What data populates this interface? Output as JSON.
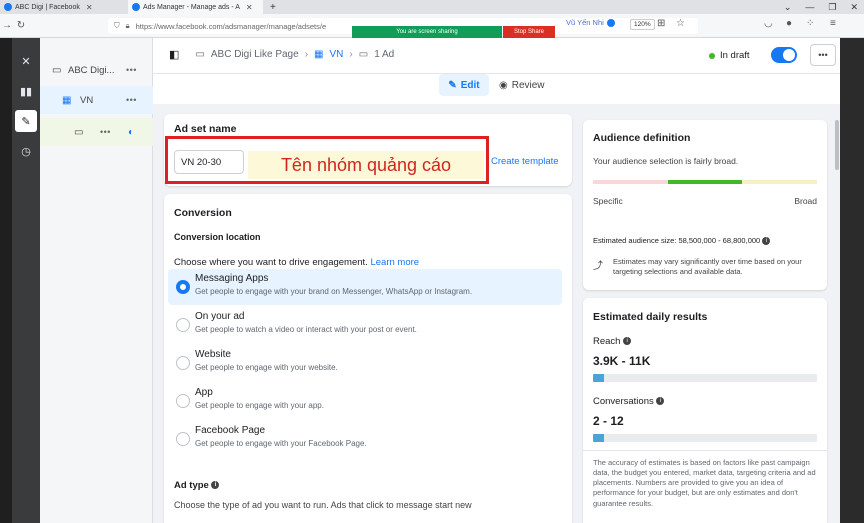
{
  "browser": {
    "tabs": [
      {
        "title": "ABC Digi | Facebook"
      },
      {
        "title": "Ads Manager - Manage ads - A"
      }
    ],
    "new_tab": "+",
    "url": "https://www.facebook.com/adsmanager/manage/adsets/e",
    "screen_share": "You are screen sharing",
    "stop_share": "Stop Share",
    "profile": "Vũ Yến Nhi",
    "zoom": "120%"
  },
  "tree": {
    "campaign": "ABC Digi...",
    "adset": "VN",
    "more": "•••"
  },
  "breadcrumb": {
    "page": "ABC Digi Like Page",
    "adset": "VN",
    "ad": "1 Ad"
  },
  "status": {
    "draft": "In draft",
    "toggle_on": true
  },
  "mode": {
    "edit": "Edit",
    "review": "Review"
  },
  "adset_name": {
    "heading": "Ad set name",
    "value": "VN 20-30",
    "create_template": "Create template",
    "annotation": "Tên nhóm quảng cáo"
  },
  "conversion": {
    "heading": "Conversion",
    "location_heading": "Conversion location",
    "question": "Choose where you want to drive engagement.",
    "learn_more": "Learn more",
    "options": [
      {
        "title": "Messaging Apps",
        "desc": "Get people to engage with your brand on Messenger, WhatsApp or Instagram.",
        "selected": true
      },
      {
        "title": "On your ad",
        "desc": "Get people to watch a video or interact with your post or event.",
        "selected": false
      },
      {
        "title": "Website",
        "desc": "Get people to engage with your website.",
        "selected": false
      },
      {
        "title": "App",
        "desc": "Get people to engage with your app.",
        "selected": false
      },
      {
        "title": "Facebook Page",
        "desc": "Get people to engage with your Facebook Page.",
        "selected": false
      }
    ],
    "ad_type_heading": "Ad type",
    "ad_type_desc": "Choose the type of ad you want to run. Ads that click to message start new"
  },
  "audience": {
    "heading": "Audience definition",
    "summary": "Your audience selection is fairly broad.",
    "specific": "Specific",
    "broad": "Broad",
    "size": "Estimated audience size: 58,500,000 - 68,800,000",
    "note": "Estimates may vary significantly over time based on your targeting selections and available data."
  },
  "daily": {
    "heading": "Estimated daily results",
    "reach_label": "Reach",
    "reach_value": "3.9K - 11K",
    "reach_fill": 0.05,
    "conv_label": "Conversations",
    "conv_value": "2 - 12",
    "conv_fill": 0.05,
    "disclaimer": "The accuracy of estimates is based on factors like past campaign data, the budget you entered, market data, targeting criteria and ad placements. Numbers are provided to give you an idea of performance for your budget, but are only estimates and don't guarantee results."
  },
  "colors": {
    "accent": "#1877f2",
    "annotation_border": "#e02020",
    "annotation_text": "#d0261d",
    "share_green": "#0f9d58"
  }
}
